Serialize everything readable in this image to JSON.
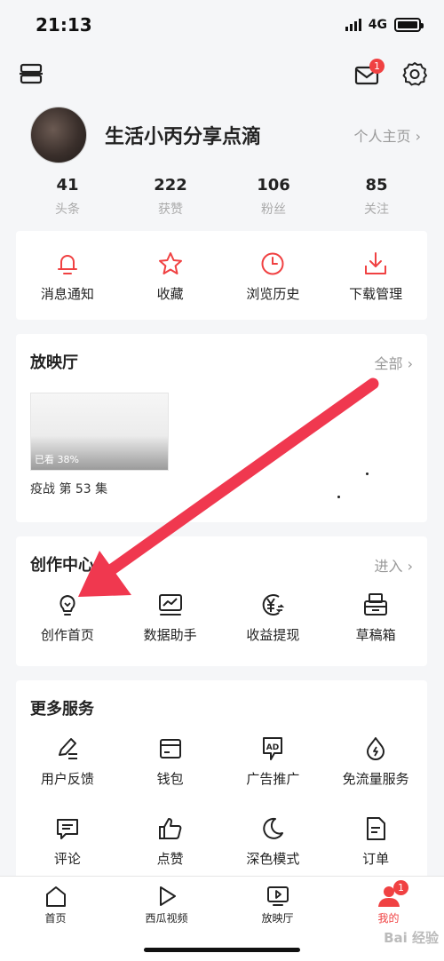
{
  "status_bar": {
    "time": "21:13",
    "network": "4G"
  },
  "header": {
    "mail_badge": "1"
  },
  "profile": {
    "username": "生活小丙分享点滴",
    "homepage_link": "个人主页 ›"
  },
  "stats": [
    {
      "value": "41",
      "label": "头条"
    },
    {
      "value": "222",
      "label": "获赞"
    },
    {
      "value": "106",
      "label": "粉丝"
    },
    {
      "value": "85",
      "label": "关注"
    }
  ],
  "quick_actions": [
    {
      "label": "消息通知",
      "icon": "bell-icon"
    },
    {
      "label": "收藏",
      "icon": "star-icon"
    },
    {
      "label": "浏览历史",
      "icon": "clock-icon"
    },
    {
      "label": "下载管理",
      "icon": "download-icon"
    }
  ],
  "theater": {
    "title": "放映厅",
    "more": "全部 ›",
    "progress_text": "已看 38%",
    "episode": "疫战 第 53 集"
  },
  "creator_center": {
    "title": "创作中心",
    "more": "进入 ›",
    "items": [
      {
        "label": "创作首页",
        "icon": "lightbulb-icon"
      },
      {
        "label": "数据助手",
        "icon": "chart-monitor-icon"
      },
      {
        "label": "收益提现",
        "icon": "yen-coin-icon"
      },
      {
        "label": "草稿箱",
        "icon": "printer-icon"
      }
    ]
  },
  "more_services": {
    "title": "更多服务",
    "items": [
      {
        "label": "用户反馈",
        "icon": "pen-icon"
      },
      {
        "label": "钱包",
        "icon": "wallet-icon"
      },
      {
        "label": "广告推广",
        "icon": "ad-icon"
      },
      {
        "label": "免流量服务",
        "icon": "droplet-icon"
      },
      {
        "label": "评论",
        "icon": "comment-icon"
      },
      {
        "label": "点赞",
        "icon": "thumbs-up-icon"
      },
      {
        "label": "深色模式",
        "icon": "moon-icon"
      },
      {
        "label": "订单",
        "icon": "document-icon"
      }
    ]
  },
  "tabbar": {
    "tabs": [
      {
        "label": "首页",
        "icon": "home-icon"
      },
      {
        "label": "西瓜视频",
        "icon": "play-icon"
      },
      {
        "label": "放映厅",
        "icon": "tv-play-icon"
      },
      {
        "label": "我的",
        "icon": "person-icon"
      }
    ],
    "me_badge": "1"
  },
  "watermark": "Bai 经验",
  "colors": {
    "accent": "#f04142",
    "arrow": "#f0384f"
  }
}
